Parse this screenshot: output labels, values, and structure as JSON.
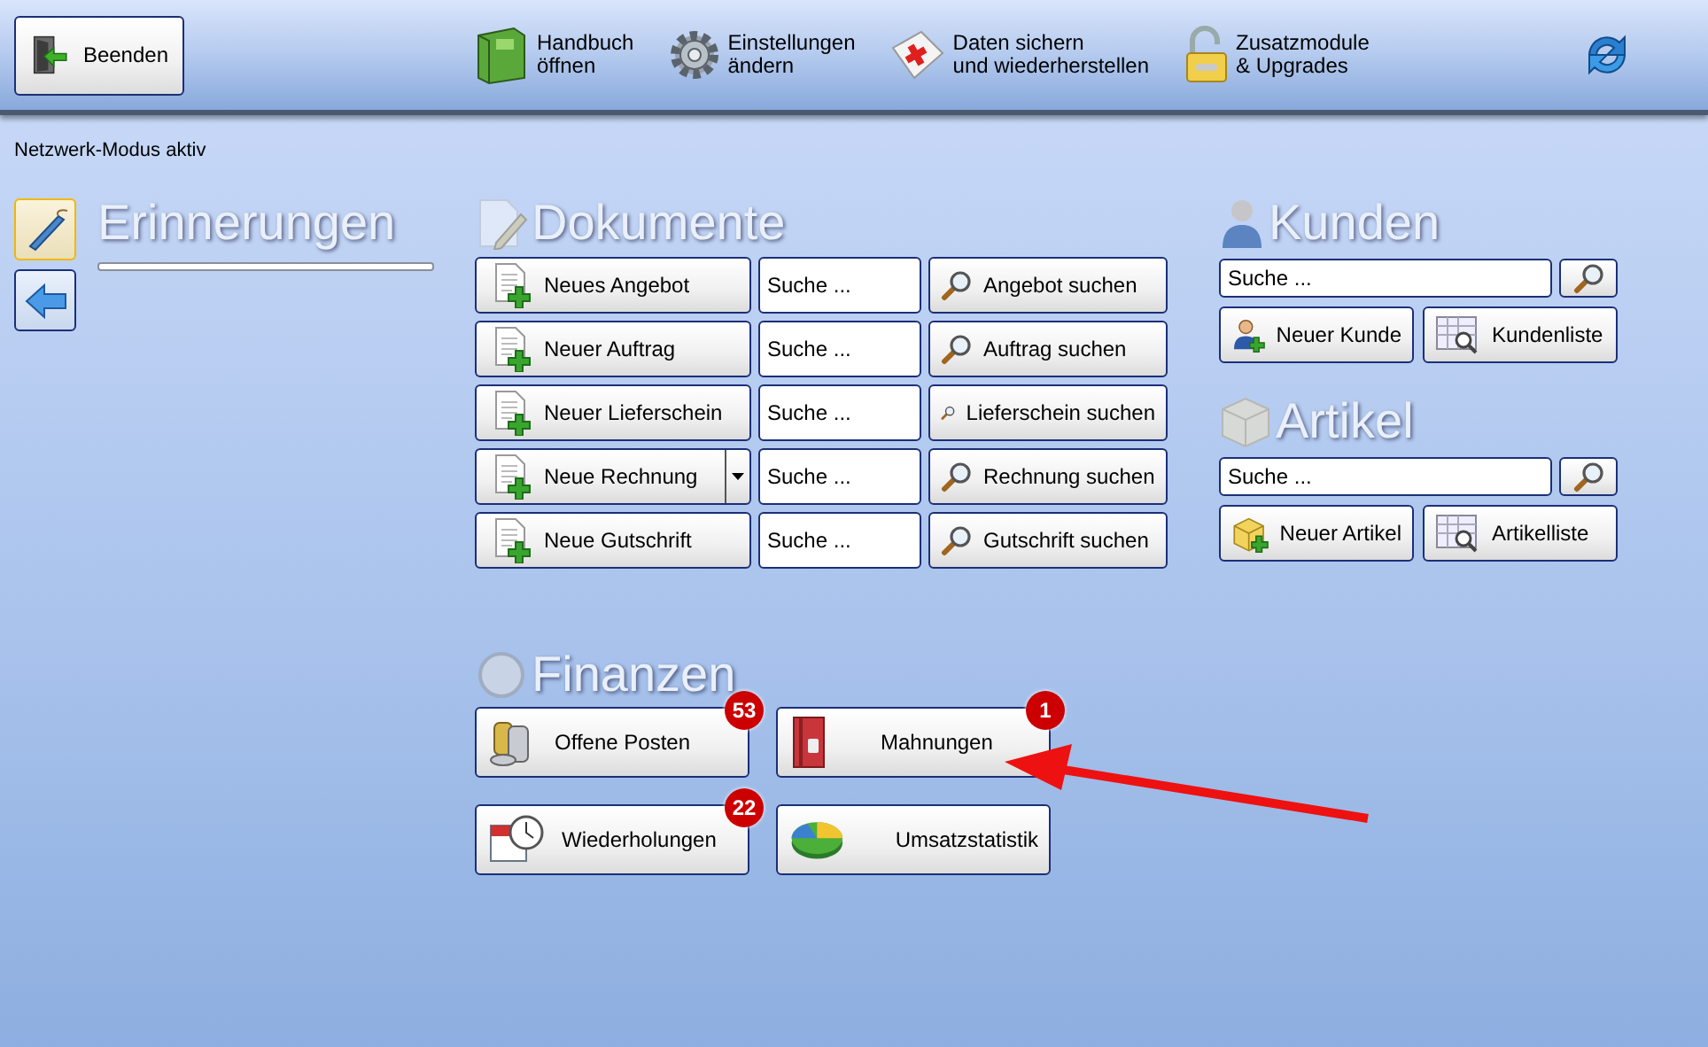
{
  "toolbar": {
    "exit_button": "Beenden",
    "items": [
      {
        "kind": "labeled",
        "lines": [
          "Handbuch",
          "öffnen"
        ]
      },
      {
        "kind": "labeled",
        "lines": [
          "Einstellungen",
          "ändern"
        ]
      },
      {
        "kind": "labeled",
        "lines": [
          "Daten sichern",
          "und wiederherstellen"
        ]
      },
      {
        "kind": "labeled",
        "lines": [
          "Zusatzmodule",
          "& Upgrades"
        ]
      },
      {
        "kind": "refresh"
      }
    ]
  },
  "status_text": "Netzwerk-Modus aktiv",
  "side_buttons": [
    {
      "selected": true
    },
    {
      "selected": false
    }
  ],
  "reminders": {
    "title": "Erinnerungen"
  },
  "documents": {
    "title": "Dokumente",
    "rows": [
      {
        "new_label": "Neues Angebot",
        "has_dropdown": false,
        "search_placeholder": "Suche ...",
        "search_button": "Angebot suchen"
      },
      {
        "new_label": "Neuer Auftrag",
        "has_dropdown": false,
        "search_placeholder": "Suche ...",
        "search_button": "Auftrag suchen"
      },
      {
        "new_label": "Neuer Lieferschein",
        "has_dropdown": false,
        "search_placeholder": "Suche ...",
        "search_button": "Lieferschein suchen"
      },
      {
        "new_label": "Neue Rechnung",
        "has_dropdown": true,
        "search_placeholder": "Suche ...",
        "search_button": "Rechnung suchen"
      },
      {
        "new_label": "Neue Gutschrift",
        "has_dropdown": false,
        "search_placeholder": "Suche ...",
        "search_button": "Gutschrift suchen"
      }
    ]
  },
  "customers": {
    "title": "Kunden",
    "search_placeholder": "Suche ...",
    "buttons": [
      "Neuer Kunde",
      "Kundenliste"
    ]
  },
  "articles": {
    "title": "Artikel",
    "search_placeholder": "Suche ...",
    "buttons": [
      "Neuer Artikel",
      "Artikelliste"
    ]
  },
  "finances": {
    "title": "Finanzen",
    "buttons": [
      {
        "label": "Offene Posten",
        "badge": "53"
      },
      {
        "label": "Mahnungen",
        "badge": "1"
      },
      {
        "label": "Wiederholungen",
        "badge": "22"
      },
      {
        "label": "Umsatzstatistik"
      }
    ]
  },
  "callout": {
    "kind": "arrow"
  }
}
